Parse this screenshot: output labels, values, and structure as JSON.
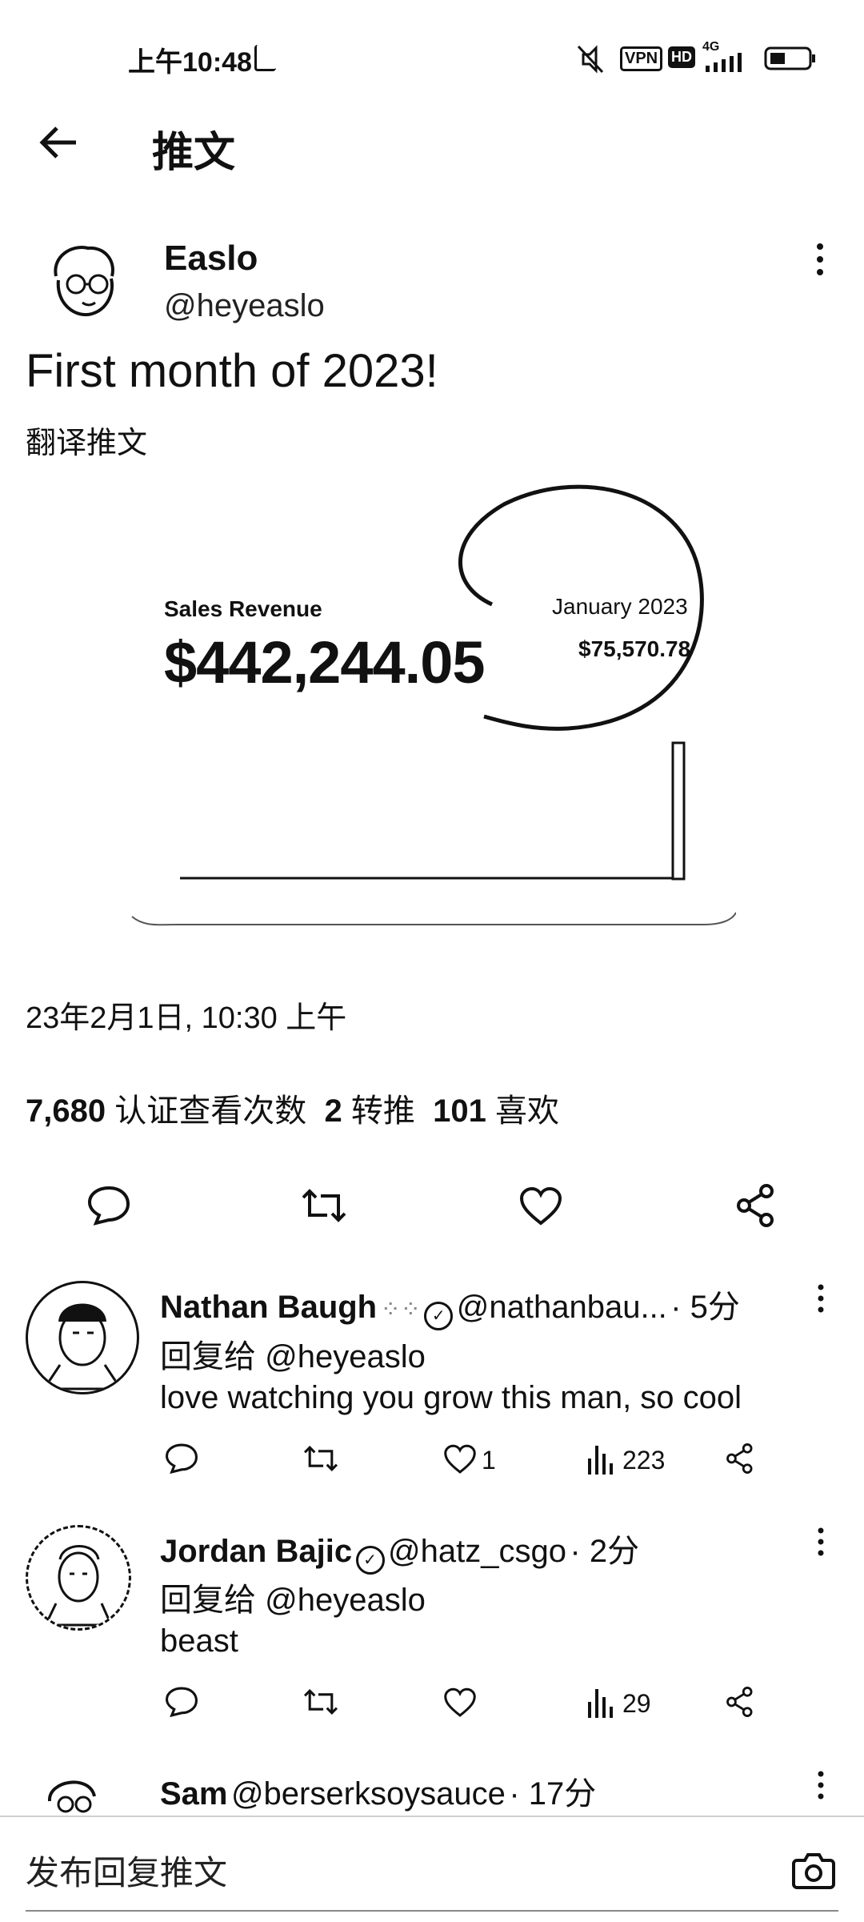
{
  "status_bar": {
    "time": "上午10:48",
    "vpn": "VPN",
    "hd": "HD",
    "network": "4G"
  },
  "header": {
    "title": "推文"
  },
  "tweet": {
    "author_name": "Easlo",
    "author_handle": "@heyeaslo",
    "text": "First month of 2023!",
    "translate": "翻译推文",
    "card": {
      "label": "Sales Revenue",
      "total": "$442,244.05",
      "month_label": "January 2023",
      "month_value": "$75,570.78"
    },
    "timestamp": "23年2月1日, 10:30 上午",
    "stats": {
      "views_count": "7,680",
      "views_label": "认证查看次数",
      "retweets_count": "2",
      "retweets_label": "转推",
      "likes_count": "101",
      "likes_label": "喜欢"
    }
  },
  "replies": [
    {
      "name": "Nathan Baugh",
      "handle": "@nathanbau...",
      "time": "· 5分",
      "reply_to": "回复给 @heyeaslo",
      "text": "love watching you grow this man, so cool",
      "likes": "1",
      "views": "223"
    },
    {
      "name": "Jordan Bajic",
      "handle": "@hatz_csgo",
      "time": "· 2分",
      "reply_to": "回复给 @heyeaslo",
      "text": "beast",
      "likes": "",
      "views": "29"
    },
    {
      "name": "Sam",
      "handle": "@berserksoysauce",
      "time": "· 17分"
    }
  ],
  "composer": {
    "placeholder": "发布回复推文"
  }
}
